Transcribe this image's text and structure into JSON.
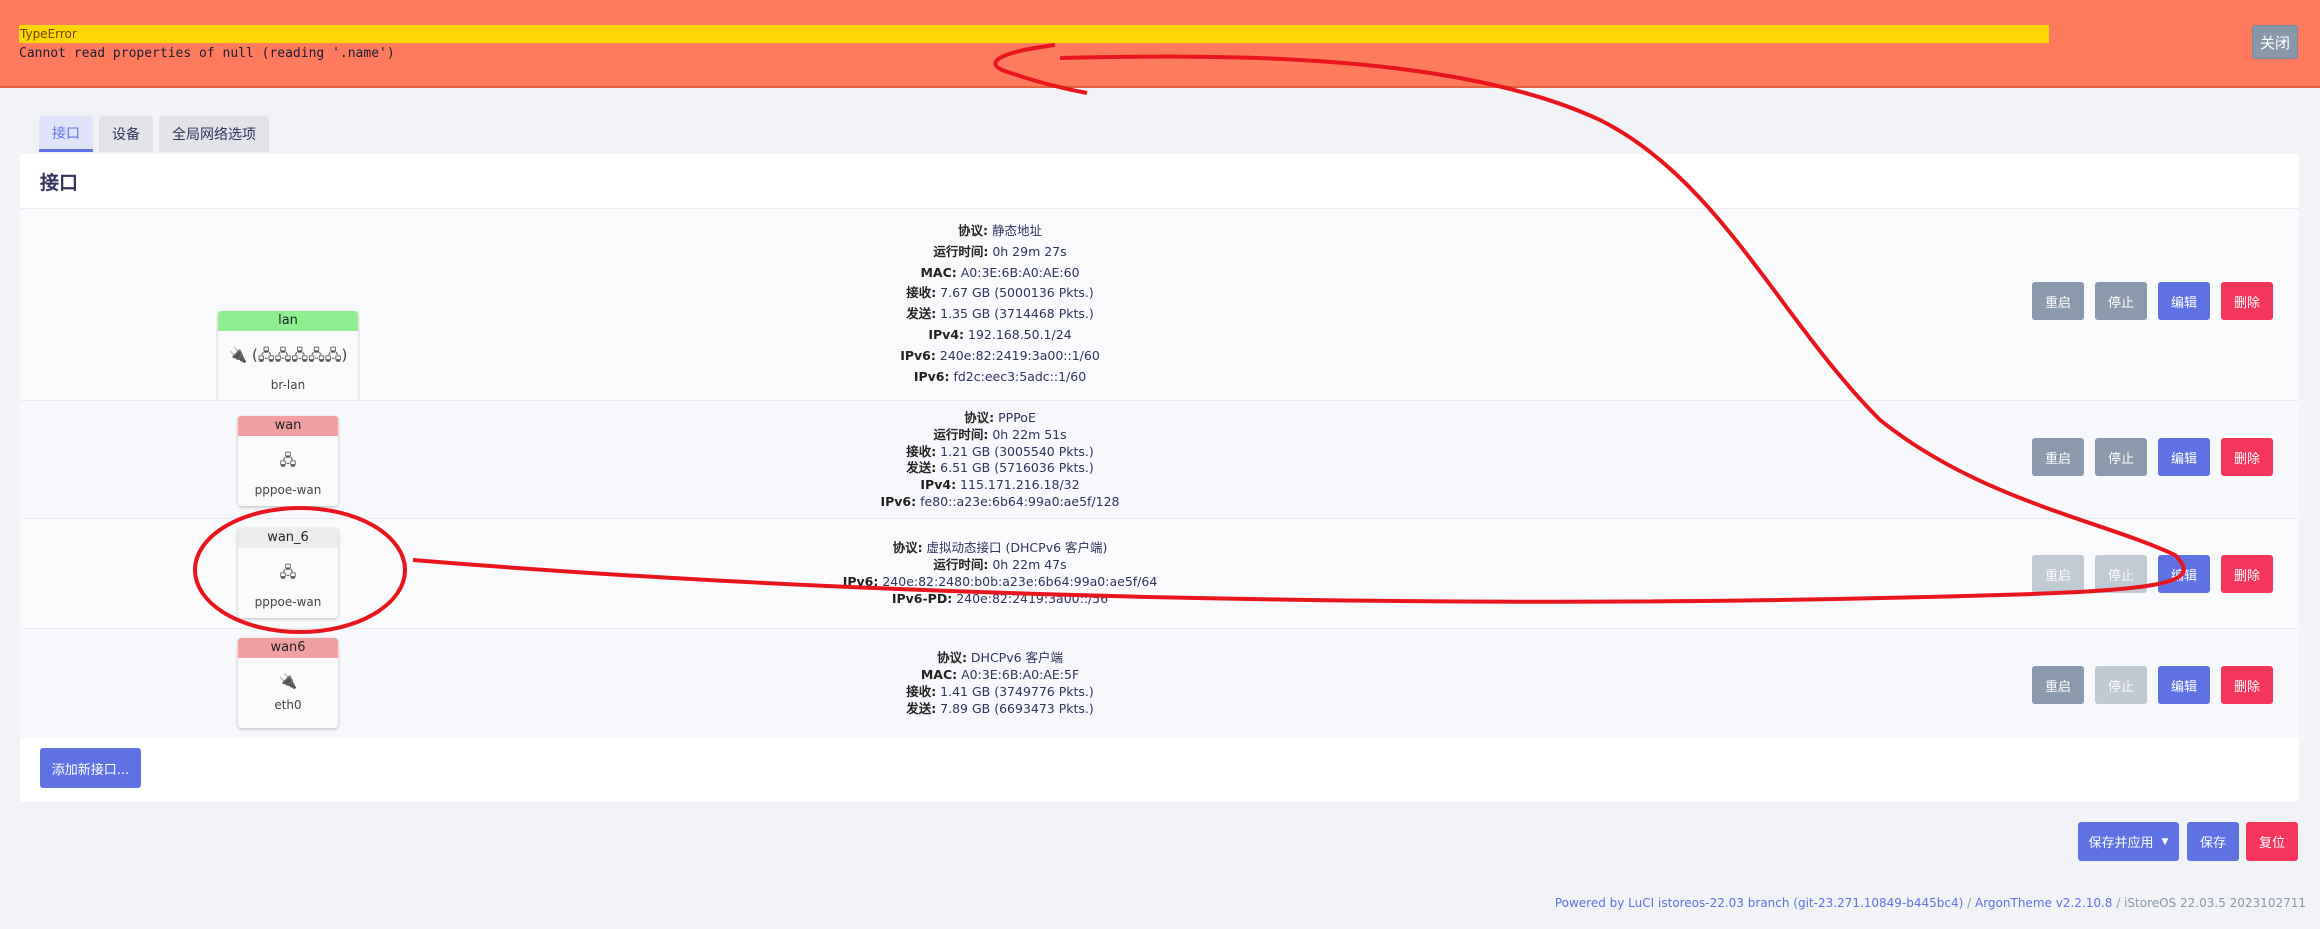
{
  "error": {
    "type": "TypeError",
    "message": "Cannot read properties of null (reading '.name')",
    "close_label": "关闭"
  },
  "tabs": [
    {
      "label": "接口",
      "active": true
    },
    {
      "label": "设备",
      "active": false
    },
    {
      "label": "全局网络选项",
      "active": false
    }
  ],
  "section_title": "接口",
  "interfaces": [
    {
      "name": "lan",
      "color": "#90ee90",
      "icons": "🔌 (🖧🖧🖧🖧🖧)",
      "device": "br-lan",
      "info": [
        {
          "k": "协议:",
          "v": " 静态地址"
        },
        {
          "k": "运行时间:",
          "v": " 0h 29m 27s"
        },
        {
          "k": "MAC:",
          "v": " A0:3E:6B:A0:AE:60"
        },
        {
          "k": "接收:",
          "v": " 7.67 GB (5000136 Pkts.)"
        },
        {
          "k": "发送:",
          "v": " 1.35 GB (3714468 Pkts.)"
        },
        {
          "k": "IPv4:",
          "v": " 192.168.50.1/24"
        },
        {
          "k": "IPv6:",
          "v": " 240e:82:2419:3a00::1/60"
        },
        {
          "k": "IPv6:",
          "v": " fd2c:eec3:5adc::1/60"
        }
      ],
      "buttons": {
        "restart": "重启",
        "stop": "停止",
        "edit": "编辑",
        "delete": "删除"
      },
      "restart_disabled": false,
      "stop_disabled": false
    },
    {
      "name": "wan",
      "color": "#f0a0a0",
      "icons": "🖧",
      "device": "pppoe-wan",
      "info": [
        {
          "k": "协议:",
          "v": " PPPoE"
        },
        {
          "k": "运行时间:",
          "v": " 0h 22m 51s"
        },
        {
          "k": "接收:",
          "v": " 1.21 GB (3005540 Pkts.)"
        },
        {
          "k": "发送:",
          "v": " 6.51 GB (5716036 Pkts.)"
        },
        {
          "k": "IPv4:",
          "v": " 115.171.216.18/32"
        },
        {
          "k": "IPv6:",
          "v": " fe80::a23e:6b64:99a0:ae5f/128"
        }
      ],
      "buttons": {
        "restart": "重启",
        "stop": "停止",
        "edit": "编辑",
        "delete": "删除"
      },
      "restart_disabled": false,
      "stop_disabled": false
    },
    {
      "name": "wan_6",
      "color": "#ececec",
      "icons": "🖧",
      "device": "pppoe-wan",
      "info": [
        {
          "k": "协议:",
          "v": " 虚拟动态接口 (DHCPv6 客户端)"
        },
        {
          "k": "运行时间:",
          "v": " 0h 22m 47s"
        },
        {
          "k": "IPv6:",
          "v": " 240e:82:2480:b0b:a23e:6b64:99a0:ae5f/64"
        },
        {
          "k": "IPv6-PD:",
          "v": " 240e:82:2419:3a00::/56"
        }
      ],
      "buttons": {
        "restart": "重启",
        "stop": "停止",
        "edit": "编辑",
        "delete": "删除"
      },
      "restart_disabled": true,
      "stop_disabled": true
    },
    {
      "name": "wan6",
      "color": "#f0a0a0",
      "icons": "🔌",
      "device": "eth0",
      "info": [
        {
          "k": "协议:",
          "v": " DHCPv6 客户端"
        },
        {
          "k": "MAC:",
          "v": " A0:3E:6B:A0:AE:5F"
        },
        {
          "k": "接收:",
          "v": " 1.41 GB (3749776 Pkts.)"
        },
        {
          "k": "发送:",
          "v": " 7.89 GB (6693473 Pkts.)"
        }
      ],
      "buttons": {
        "restart": "重启",
        "stop": "停止",
        "edit": "编辑",
        "delete": "删除"
      },
      "restart_disabled": false,
      "stop_disabled": true
    }
  ],
  "add_interface_label": "添加新接口...",
  "actions": {
    "apply_label": "保存并应用",
    "save_label": "保存",
    "reset_label": "复位"
  },
  "footer": {
    "luci": "Powered by LuCI istoreos-22.03 branch (git-23.271.10849-b445bc4)",
    "sep1": " / ",
    "theme": "ArgonTheme v2.2.10.8",
    "sep2": " / ",
    "os": "iStoreOS 22.03.5 2023102711"
  },
  "colors": {
    "primary": "#5e72e4",
    "danger": "#f5365c",
    "secondary": "#8a99ab",
    "error_bg": "#fe7b5e",
    "error_type_bg": "#ffd700",
    "annotation": "#e8151c"
  }
}
